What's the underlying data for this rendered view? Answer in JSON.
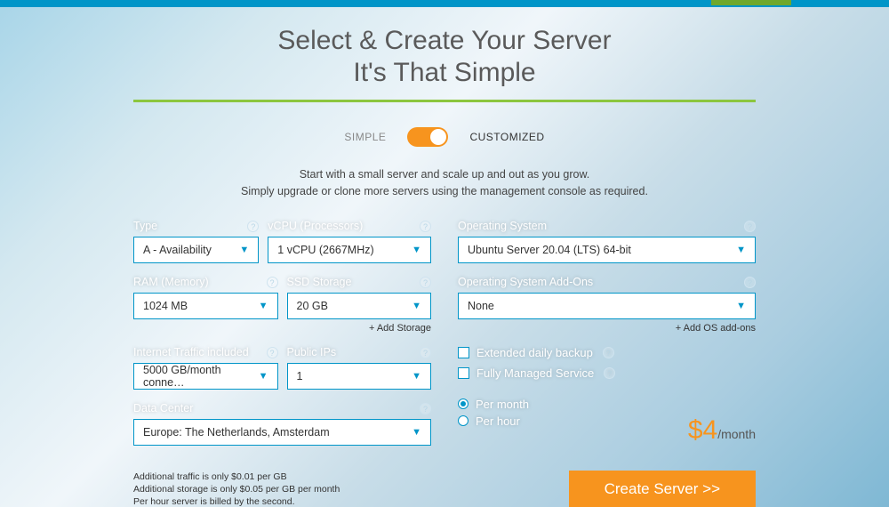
{
  "heading_line1": "Select & Create Your Server",
  "heading_line2": "It's That Simple",
  "mode_simple": "SIMPLE",
  "mode_customized": "CUSTOMIZED",
  "intro_line1": "Start with a small server and scale up and out as you grow.",
  "intro_line2": "Simply upgrade or clone more servers using the management console as required.",
  "labels": {
    "type": "Type",
    "vcpu": "vCPU (Processors)",
    "ram": "RAM (Memory)",
    "ssd": "SSD Storage",
    "traffic": "Internet Traffic included",
    "ips": "Public IPs",
    "dc": "Data Center",
    "os": "Operating System",
    "os_addons": "Operating System Add-Ons"
  },
  "values": {
    "type": "A - Availability",
    "vcpu": "1 vCPU (2667MHz)",
    "ram": "1024 MB",
    "ssd": "20 GB",
    "traffic": "5000 GB/month conne…",
    "ips": "1",
    "dc": "Europe: The Netherlands, Amsterdam",
    "os": "Ubuntu Server 20.04 (LTS) 64-bit",
    "os_addons": "None"
  },
  "links": {
    "add_storage": "+ Add Storage",
    "add_os_addons": "+ Add OS add-ons"
  },
  "options": {
    "backup": "Extended daily backup",
    "managed": "Fully Managed Service",
    "per_month": "Per month",
    "per_hour": "Per hour"
  },
  "price": {
    "amount": "$4",
    "unit": "/month"
  },
  "fine_print": {
    "l1": "Additional traffic is only $0.01 per GB",
    "l2": "Additional storage is only $0.05 per GB per month",
    "l3": "Per hour server is billed by the second."
  },
  "cta": "Create Server >>"
}
